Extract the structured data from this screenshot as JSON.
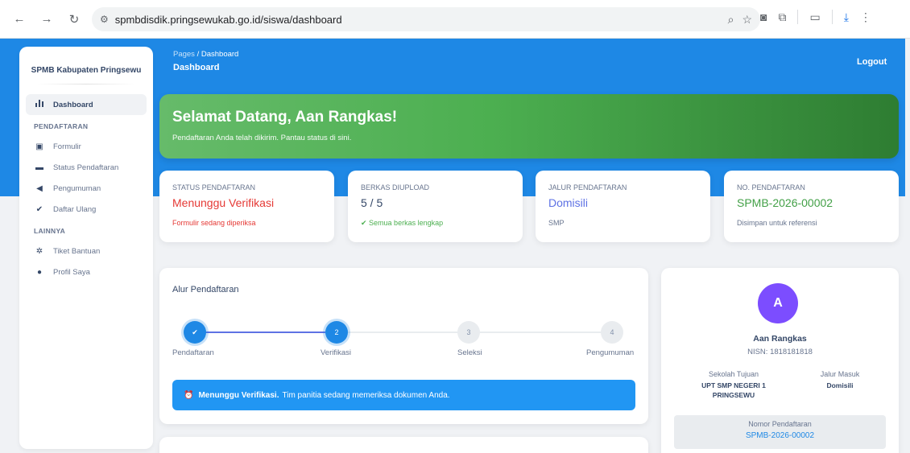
{
  "browser": {
    "url": "spmbdisdik.pringsewukab.go.id/siswa/dashboard",
    "icons": [
      "back-icon",
      "forward-icon",
      "reload-icon",
      "site-settings-icon",
      "zoom-icon",
      "bookmark-star-icon",
      "camera-icon",
      "extensions-icon",
      "sidebar-icon",
      "download-icon",
      "menu-icon"
    ]
  },
  "sidebar": {
    "brand": "SPMB Kabupaten Pringsewu",
    "items": [
      {
        "label": "Dashboard",
        "icon": "bar-chart-icon",
        "glyph": "📊",
        "active": true
      }
    ],
    "section_pendaftaran": "PENDAFTARAN",
    "pendaftaran_items": [
      {
        "label": "Formulir",
        "icon": "clipboard-icon",
        "glyph": "▣"
      },
      {
        "label": "Status Pendaftaran",
        "icon": "folder-icon",
        "glyph": "▬"
      },
      {
        "label": "Pengumuman",
        "icon": "megaphone-icon",
        "glyph": "◀"
      },
      {
        "label": "Daftar Ulang",
        "icon": "check-icon",
        "glyph": "✔"
      }
    ],
    "section_lainnya": "LAINNYA",
    "lainnya_items": [
      {
        "label": "Tiket Bantuan",
        "icon": "lifebuoy-icon",
        "glyph": "✲"
      },
      {
        "label": "Profil Saya",
        "icon": "user-circle-icon",
        "glyph": "●"
      }
    ]
  },
  "header": {
    "breadcrumb_root": "Pages",
    "breadcrumb_sep": " / ",
    "breadcrumb_current": "Dashboard",
    "title": "Dashboard",
    "logout": "Logout"
  },
  "welcome": {
    "title": "Selamat Datang, Aan Rangkas!",
    "subtitle": "Pendaftaran Anda telah dikirim. Pantau status di sini."
  },
  "stats": [
    {
      "label": "STATUS PENDAFTARAN",
      "value": "Menunggu Verifikasi",
      "sub": "Formulir sedang diperiksa",
      "value_color": "#e53935",
      "sub_color": "#e53935"
    },
    {
      "label": "BERKAS DIUPLOAD",
      "value": "5 / 5",
      "sub": "✔ Semua berkas lengkap",
      "value_color": "#344767",
      "sub_color": "#4caf50"
    },
    {
      "label": "JALUR PENDAFTARAN",
      "value": "Domisili",
      "sub": "SMP",
      "value_color": "#5e72e4",
      "sub_color": "#67748e"
    },
    {
      "label": "NO. PENDAFTARAN",
      "value": "SPMB-2026-00002",
      "sub": "Disimpan untuk referensi",
      "value_color": "#43a047",
      "sub_color": "#67748e"
    }
  ],
  "alur": {
    "title": "Alur Pendaftaran",
    "steps": [
      {
        "label": "Pendaftaran",
        "marker": "✔",
        "state": "done"
      },
      {
        "label": "Verifikasi",
        "marker": "2",
        "state": "active"
      },
      {
        "label": "Seleksi",
        "marker": "3",
        "state": "pending"
      },
      {
        "label": "Pengumuman",
        "marker": "4",
        "state": "pending"
      }
    ],
    "alert_icon": "⏰",
    "alert_bold": "Menunggu Verifikasi.",
    "alert_text": "Tim panitia sedang memeriksa dokumen Anda."
  },
  "profile": {
    "avatar_letter": "A",
    "name": "Aan Rangkas",
    "nisn": "NISN: 1818181818",
    "sekolah_label": "Sekolah Tujuan",
    "sekolah_value": "UPT SMP NEGERI 1 PRINGSEWU",
    "jalur_label": "Jalur Masuk",
    "jalur_value": "Domisili",
    "nomor_label": "Nomor Pendaftaran",
    "nomor_value": "SPMB-2026-00002"
  },
  "colors": {
    "primary": "#1e88e5",
    "success": "#4caf50",
    "danger": "#e53935",
    "avatar": "#7c4dff"
  }
}
